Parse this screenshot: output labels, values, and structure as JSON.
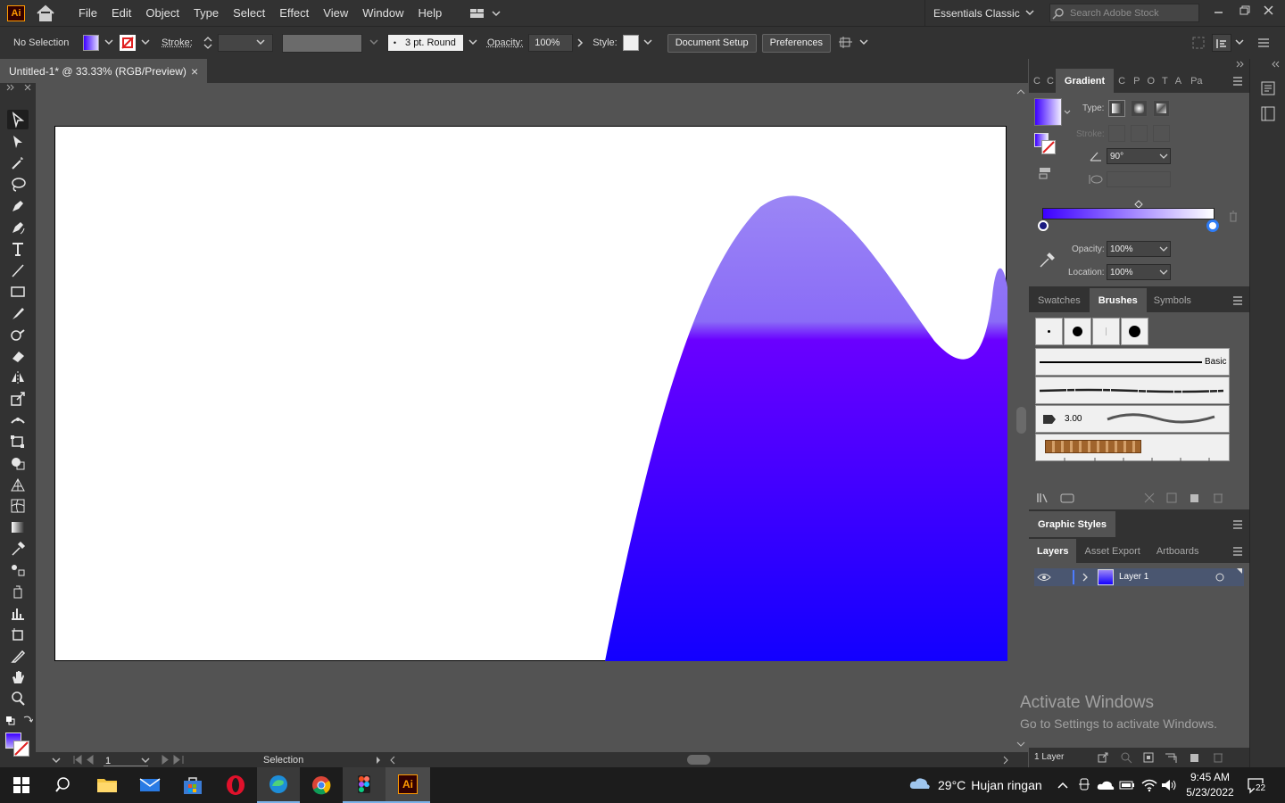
{
  "app": {
    "logo": "Ai",
    "workspace": "Essentials Classic",
    "search_placeholder": "Search Adobe Stock"
  },
  "menu": [
    "File",
    "Edit",
    "Object",
    "Type",
    "Select",
    "Effect",
    "View",
    "Window",
    "Help"
  ],
  "control": {
    "selection": "No Selection",
    "stroke_label": "Stroke:",
    "brush": "3 pt. Round",
    "opacity_label": "Opacity:",
    "opacity": "100%",
    "style_label": "Style:",
    "document_setup": "Document Setup",
    "preferences": "Preferences"
  },
  "document": {
    "tab_title": "Untitled-1* @ 33.33% (RGB/Preview)",
    "close": "×"
  },
  "status": {
    "artboard_number": "1",
    "tool": "Selection"
  },
  "gradient_panel": {
    "tabs": [
      "C",
      "C",
      "Gradient",
      "C",
      "P",
      "O",
      "T",
      "A",
      "Pa"
    ],
    "active_tab": "Gradient",
    "type_label": "Type:",
    "stroke_label": "Stroke:",
    "angle": "90°",
    "opacity_label": "Opacity:",
    "opacity": "100%",
    "location_label": "Location:",
    "location": "100%",
    "start_color": "#3c00ff",
    "end_color": "#ffffff"
  },
  "brushes_panel": {
    "tabs": [
      "Swatches",
      "Brushes",
      "Symbols"
    ],
    "active_tab": "Brushes",
    "basic_label": "Basic",
    "size_label": "3.00"
  },
  "graphic_styles": {
    "title": "Graphic Styles"
  },
  "layers_panel": {
    "tabs": [
      "Layers",
      "Asset Export",
      "Artboards"
    ],
    "active_tab": "Layers",
    "layer_name": "Layer 1",
    "count": "1 Layer"
  },
  "watermark": {
    "line1": "Activate Windows",
    "line2": "Go to Settings to activate Windows."
  },
  "taskbar": {
    "weather_temp": "29°C",
    "weather_text": "Hujan ringan",
    "time": "9:45 AM",
    "date": "5/23/2022",
    "notification_count": "22"
  },
  "artwork": {
    "gradient_top": "#9b86f5",
    "gradient_mid": "#6a00ff",
    "gradient_bottom": "#1200ff"
  }
}
